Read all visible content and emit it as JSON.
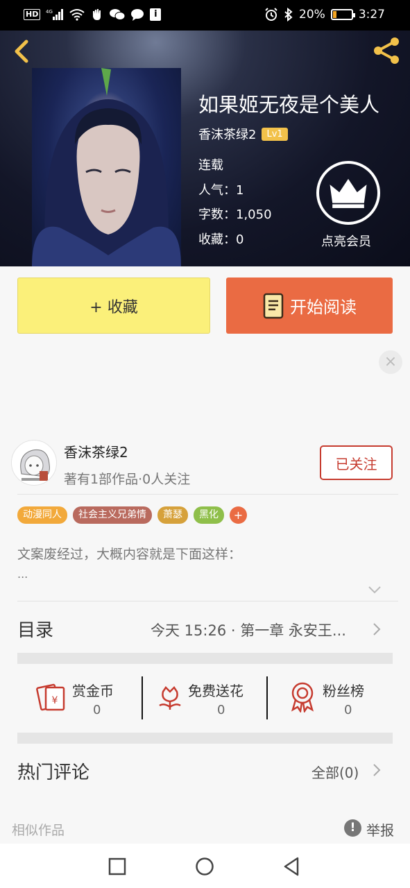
{
  "status_bar": {
    "left_icons": [
      "hd-icon",
      "4g-signal-icon",
      "wifi-icon",
      "hand-icon",
      "wechat-icon",
      "message-icon",
      "info-icon"
    ],
    "battery_percent": "20%",
    "battery_level": 0.2,
    "time": "3:27"
  },
  "book": {
    "title": "如果姬无夜是个美人",
    "author": "香沫茶绿2",
    "level": "Lv1",
    "status": "连载",
    "popularity": "人气：1",
    "word_count": "字数：1,050",
    "favorites": "收藏：0",
    "vip_label": "点亮会员"
  },
  "actions": {
    "favorite_label": "+ 收藏",
    "read_label": "开始阅读"
  },
  "author_card": {
    "name": "香沫茶绿2",
    "stats": "著有1部作品·0人关注",
    "follow_label": "已关注"
  },
  "tags": [
    {
      "label": "动漫同人",
      "color": "#f2a93b"
    },
    {
      "label": "社会主义兄弟情",
      "color": "#b96a5e"
    },
    {
      "label": "萧瑟",
      "color": "#d6a13b"
    },
    {
      "label": "黑化",
      "color": "#8fbf4a"
    }
  ],
  "tag_more": "+",
  "description": {
    "text": "文案废经过，大概内容就是下面这样：",
    "ellipsis": "..."
  },
  "catalog": {
    "label": "目录",
    "latest": "今天 15:26 · 第一章 永安王..."
  },
  "stats": {
    "reward": {
      "label": "赏金币",
      "value": "0"
    },
    "flowers": {
      "label": "免费送花",
      "value": "0"
    },
    "fans": {
      "label": "粉丝榜",
      "value": "0"
    }
  },
  "comments": {
    "label": "热门评论",
    "all": "全部(0)"
  },
  "footer": {
    "similar": "相似作品",
    "report": "举报"
  },
  "colors": {
    "accent_orange": "#ea6b43",
    "favorite_yellow": "#fbf07a",
    "follow_red": "#c63b2f",
    "gold": "#f2c14a"
  }
}
